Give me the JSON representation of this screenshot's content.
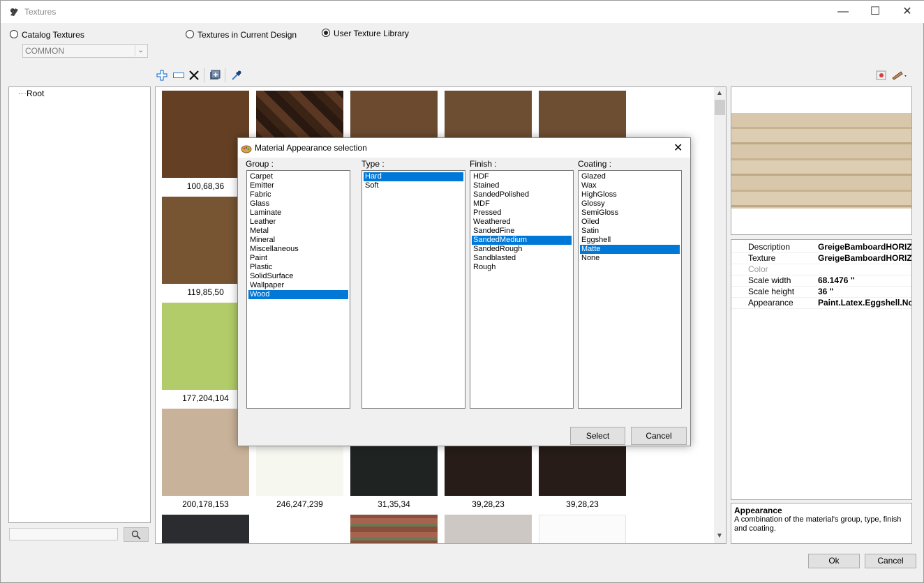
{
  "window": {
    "title": "Textures"
  },
  "source_options": [
    {
      "label": "Catalog Textures",
      "selected": false
    },
    {
      "label": "Textures in Current Design",
      "selected": false
    },
    {
      "label": "User Texture Library",
      "selected": true
    }
  ],
  "catalog_combo": {
    "value": "COMMON"
  },
  "tree": {
    "root": "Root"
  },
  "tiles": [
    {
      "label": "100,68,36",
      "color": "#643f23"
    },
    {
      "label": "",
      "color": "#3a2418"
    },
    {
      "label": "",
      "color": "#6b4a2f"
    },
    {
      "label": "",
      "color": "#6e4e33"
    },
    {
      "label": "",
      "color": "#6e4e33"
    },
    {
      "label": "119,85,50",
      "color": "#775532"
    },
    {
      "label": "177,204,104",
      "color": "#b1cc68"
    },
    {
      "label": "200,178,153",
      "color": "#c8b299"
    },
    {
      "label": "246,247,239",
      "color": "#f6f7ef"
    },
    {
      "label": "31,35,34",
      "color": "#1f2322"
    },
    {
      "label": "39,28,23",
      "color": "#271c17"
    },
    {
      "label": "39,28,23",
      "color": "#271c17"
    }
  ],
  "dialog": {
    "title": "Material Appearance selection",
    "group_label": "Group :",
    "type_label": "Type :",
    "finish_label": "Finish :",
    "coating_label": "Coating :",
    "groups": [
      "Carpet",
      "Emitter",
      "Fabric",
      "Glass",
      "Laminate",
      "Leather",
      "Metal",
      "Mineral",
      "Miscellaneous",
      "Paint",
      "Plastic",
      "SolidSurface",
      "Wallpaper",
      "Wood"
    ],
    "group_selected": "Wood",
    "types": [
      "Hard",
      "Soft"
    ],
    "type_selected": "Hard",
    "finishes": [
      "HDF",
      "Stained",
      "SandedPolished",
      "MDF",
      "Pressed",
      "Weathered",
      "SandedFine",
      "SandedMedium",
      "SandedRough",
      "Sandblasted",
      "Rough"
    ],
    "finish_selected": "SandedMedium",
    "coatings": [
      "Glazed",
      "Wax",
      "HighGloss",
      "Glossy",
      "SemiGloss",
      "Oiled",
      "Satin",
      "Eggshell",
      "Matte",
      "None"
    ],
    "coating_selected": "Matte",
    "select_label": "Select",
    "cancel_label": "Cancel"
  },
  "properties": [
    {
      "name": "Description",
      "value": "GreigeBamboardHORIZ",
      "disabled": false
    },
    {
      "name": "Texture",
      "value": "GreigeBamboardHORIZ",
      "disabled": false
    },
    {
      "name": "Color",
      "value": "",
      "disabled": true
    },
    {
      "name": "Scale width",
      "value": "68.1476 \"",
      "disabled": false
    },
    {
      "name": "Scale height",
      "value": "36 \"",
      "disabled": false
    },
    {
      "name": "Appearance",
      "value": "Paint.Latex.Eggshell.No",
      "disabled": false
    }
  ],
  "help": {
    "title": "Appearance",
    "text": "A combination of the material's group, type, finish and coating."
  },
  "footer": {
    "ok_label": "Ok",
    "cancel_label": "Cancel"
  },
  "colors": {
    "selection": "#0078d7",
    "preview_wood": "#cbb89c"
  },
  "icons": {
    "toolbar": [
      "add-icon",
      "rename-icon",
      "delete-icon",
      "import-icon",
      "eyedropper-icon"
    ],
    "right_toolbar": [
      "picture-icon",
      "measure-icon"
    ]
  }
}
